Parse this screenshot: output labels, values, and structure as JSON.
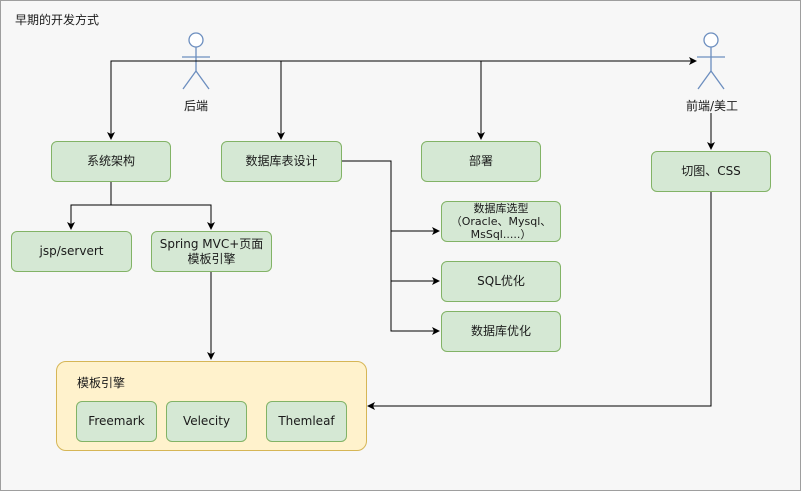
{
  "diagram": {
    "title": "早期的开发方式",
    "actors": {
      "backend": "后端",
      "frontend": "前端/美工"
    },
    "nodes": {
      "system_arch": "系统架构",
      "db_table_design": "数据库表设计",
      "deploy": "部署",
      "slicing_css": "切图、CSS",
      "jsp_servlet": "jsp/servert",
      "spring_mvc": "Spring MVC+页面模板引擎",
      "db_selection": "数据库选型（Oracle、Mysql、MsSql.....）",
      "sql_optimize": "SQL优化",
      "db_optimize": "数据库优化"
    },
    "template_group": {
      "label": "模板引擎",
      "items": [
        "Freemark",
        "Velecity",
        "Themleaf"
      ]
    }
  },
  "colors": {
    "node_fill": "#d5e8d4",
    "node_border": "#82b366",
    "group_fill": "#fff2cc",
    "group_border": "#d6b656",
    "actor_stroke": "#6c8ebf",
    "line": "#000000"
  }
}
